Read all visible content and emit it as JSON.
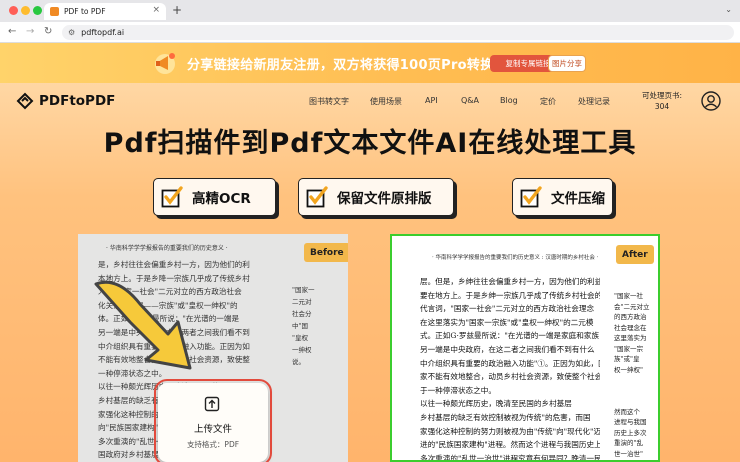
{
  "browser": {
    "tab_title": "PDF to PDF",
    "url": "pdftopdf.ai"
  },
  "banner": {
    "text": "分享链接给新朋友注册，双方将获得100页Pro转换",
    "copy_button": "复制专属链接",
    "share_button": "图片分享"
  },
  "header": {
    "logo_text": "PDFtoPDF",
    "menu": [
      "图书转文字",
      "使用场景",
      "API",
      "Q&A",
      "Blog",
      "定价",
      "处理记录"
    ],
    "quota_label": "可处理页书:",
    "quota_value": "304"
  },
  "hero": {
    "title": "Pdf扫描件到Pdf文本文件AI在线处理工具",
    "features": [
      "高精OCR",
      "保留文件原排版",
      "文件压缩"
    ]
  },
  "compare": {
    "before_label": "Before",
    "after_label": "After",
    "upload_title": "上传文件",
    "upload_formats": "支持格式：PDF",
    "before_header": "· 华南科学学学报报告的重要我们的历史意义 ·",
    "before_lines": [
      "是，乡村往往会偏重乡村一方，因为他们的利",
      "本地方上。于是乡降一宗族几乎成了传统乡村",
      "人，\"国家一社会\"二元对立的西方政治社会",
      "化关系，国家——宗族\"或\"皇权一绅权\"的",
      "体。正如G·罗兹曼所说：\"在光谱的一端是",
      "另一端是中央政府。在这两者之间我们看不到",
      "中介组织具有重要的政治融入功能。正因为如",
      "不能有效地整合，动员乡村社会资源，致使整",
      "一种停滞状态之中。",
      "以往一种颇光辉历史，晚清至民国的",
      "乡村基层的缺乏有效控制被视为传统的危",
      "家强化这种控制的努力则被视为由\"传统\"",
      "向\"民族国家建构\"演进。然而这个进程与",
      "多次重演的\"乱世一治世\"进程究竟有何异",
      "国政府对乡村基层的控制力量，但在那样一"
    ],
    "before_margin_lines": [
      "\"国家一",
      "二元对",
      "社会分",
      "中\"国",
      "\"皇权",
      "一绅权",
      "说。"
    ],
    "after_header": "· 华南科学学学报报告的重要我们的历史意义 : 汉唐时期的乡村社会 ·",
    "after_lines": [
      "层。但是，乡绅往往会偏重乡村一方，因为他们的利益主",
      "要在地方上。于是乡绅一宗族几乎成了传统乡村社会的",
      "代言词，\"国家一社会\"二元对立的西方政治社会理念",
      "在这里落实为\"国家一宗族\"或\"皇权一绅权\"的二元模",
      "式。正如G·罗兹曼所说：\"在光谱的一端是家庭和家族，",
      "另一端是中央政府，在这二者之间我们看不到有什么",
      "中介组织具有重要的政治融入功能\"①。正因为如此，国",
      "家不能有效地整合，动员乡村社会资源，致使整个社会处",
      "于一种停滞状态之中。",
      "以往一种颇光辉历史，晚清至民国的乡村基层",
      "乡村基层的缺乏有效控制被视为传统\"的危害，而国",
      "家强化这种控制的努力则被视为由\"传统\"向\"现代化\"迈",
      "进的\"民族国家建构\"进程。然而这个进程与我国历史上",
      "多次重演的\"乱世一治世\"进程究竟有何异同？晚清一民",
      "国政府对乡村基层的控制力量，但在那样一个社会，中央"
    ],
    "after_margin_lines": [
      "\"国家一社",
      "会\"二元对立",
      "的西方政治",
      "社会理念在",
      "这里落实为",
      "\"国家一宗",
      "族\"或\"皇",
      "权一绅权\"",
      "",
      "",
      "",
      "然而这个",
      "进程与我国",
      "历史上多次",
      "重演的\"乱",
      "世一治世\""
    ]
  },
  "colors": {
    "banner_bg": "#ffc04f",
    "hero_bg": "#ffc27e",
    "after_border": "#3bcd2e",
    "upload_outline": "#e24a3c",
    "badge_bg": "#f2b84b",
    "copy_button_bg": "#e2553d",
    "arrow": "#f6c93a"
  },
  "icons": {
    "browser_close": "close-icon",
    "new_tab": "plus-icon",
    "back": "arrow-left-icon",
    "forward": "arrow-right-icon",
    "reload": "reload-icon",
    "site_settings": "tune-icon",
    "gift": "megaphone-gift-icon",
    "logo": "pdftopdf-logo-icon",
    "user": "user-circle-icon",
    "feature": "checkbox-checked-icon",
    "upload": "upload-icon",
    "arrow": "big-arrow-icon"
  }
}
